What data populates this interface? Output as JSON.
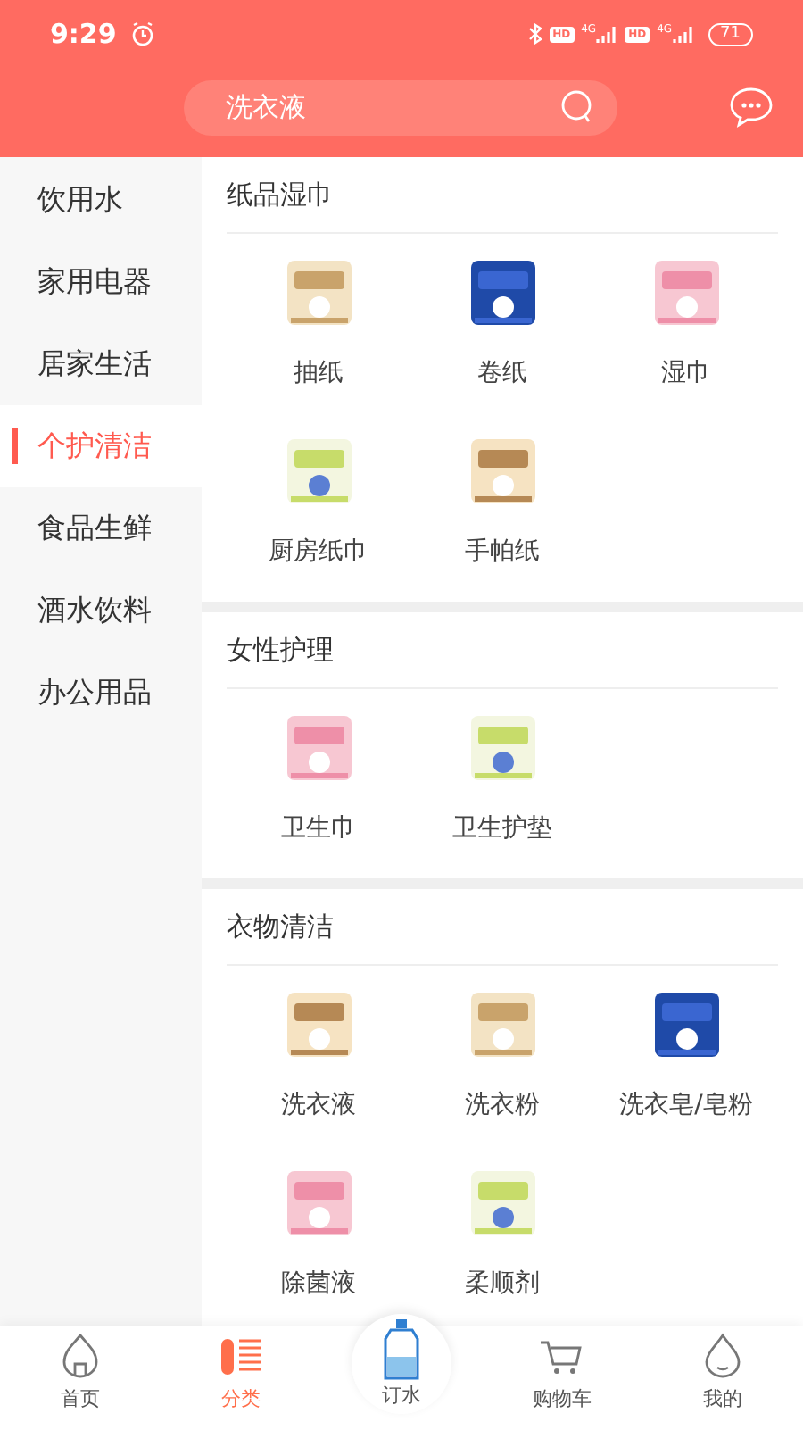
{
  "status_bar": {
    "time": "9:29",
    "hd_1": "HD",
    "network_1": "4G",
    "hd_2": "HD",
    "network_2": "4G",
    "battery": "71"
  },
  "search": {
    "value": "洗衣液"
  },
  "sidebar": {
    "items": [
      {
        "label": "饮用水",
        "selected": false
      },
      {
        "label": "家用电器",
        "selected": false
      },
      {
        "label": "居家生活",
        "selected": false
      },
      {
        "label": "个护清洁",
        "selected": true
      },
      {
        "label": "食品生鲜",
        "selected": false
      },
      {
        "label": "酒水饮料",
        "selected": false
      },
      {
        "label": "办公用品",
        "selected": false
      }
    ]
  },
  "sections": [
    {
      "title": "纸品湿巾",
      "items": [
        {
          "label": "抽纸"
        },
        {
          "label": "卷纸"
        },
        {
          "label": "湿巾"
        },
        {
          "label": "厨房纸巾"
        },
        {
          "label": "手帕纸"
        }
      ]
    },
    {
      "title": "女性护理",
      "items": [
        {
          "label": "卫生巾"
        },
        {
          "label": "卫生护垫"
        }
      ]
    },
    {
      "title": "衣物清洁",
      "items": [
        {
          "label": "洗衣液"
        },
        {
          "label": "洗衣粉"
        },
        {
          "label": "洗衣皂/皂粉"
        },
        {
          "label": "除菌液"
        },
        {
          "label": "柔顺剂"
        }
      ]
    }
  ],
  "tab_bar": {
    "tabs": [
      {
        "label": "首页",
        "kind": "home",
        "selected": false
      },
      {
        "label": "分类",
        "kind": "category",
        "selected": true
      },
      {
        "label": "订水",
        "kind": "water",
        "selected": false
      },
      {
        "label": "购物车",
        "kind": "cart",
        "selected": false
      },
      {
        "label": "我的",
        "kind": "profile",
        "selected": false
      }
    ]
  }
}
